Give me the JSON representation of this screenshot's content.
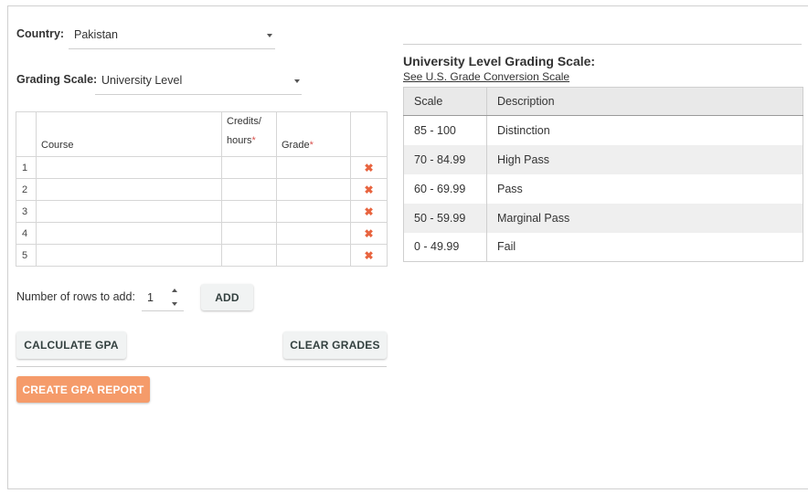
{
  "form": {
    "country_label": "Country:",
    "country_value": "Pakistan",
    "grading_label": "Grading Scale:",
    "grading_value": "University Level"
  },
  "course_table": {
    "headers": {
      "course": "Course",
      "credits_line1": "Credits/",
      "credits_line2": "hours",
      "grade": "Grade",
      "required_mark": "*"
    },
    "rows": [
      "1",
      "2",
      "3",
      "4",
      "5"
    ],
    "delete_icon": "✖"
  },
  "rows_add": {
    "label": "Number of rows to add:",
    "value": "1",
    "add_label": "ADD"
  },
  "buttons": {
    "calculate": "CALCULATE GPA",
    "clear": "CLEAR GRADES",
    "report": "CREATE GPA REPORT"
  },
  "scale": {
    "title": "University Level Grading Scale:",
    "link": "See U.S. Grade Conversion Scale",
    "headers": [
      "Scale",
      "Description"
    ],
    "rows": [
      {
        "scale": "85 - 100",
        "description": "Distinction"
      },
      {
        "scale": "70 - 84.99",
        "description": "High Pass"
      },
      {
        "scale": "60 - 69.99",
        "description": "Pass"
      },
      {
        "scale": "50 - 59.99",
        "description": "Marginal Pass"
      },
      {
        "scale": "0 - 49.99",
        "description": "Fail"
      }
    ]
  },
  "colors": {
    "accent_orange": "#f59b6a",
    "delete_red": "#e8643f",
    "required": "#d9534f"
  }
}
